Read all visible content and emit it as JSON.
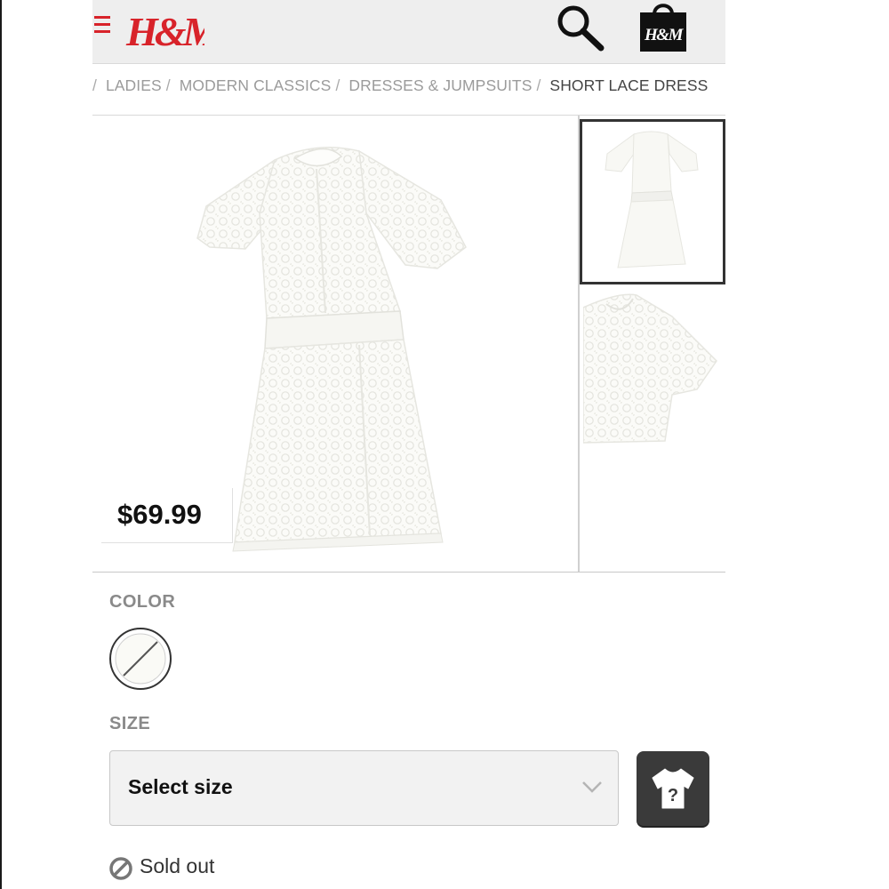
{
  "header": {
    "logo_text": "H&M",
    "bag_logo_text": "H&M",
    "icons": {
      "menu": "menu-icon",
      "search": "search-icon",
      "bag": "shopping-bag-icon"
    },
    "brand_color": "#d8232a"
  },
  "breadcrumb": {
    "separator": "/",
    "items": [
      "LADIES",
      "MODERN CLASSICS",
      "DRESSES & JUMPSUITS",
      "SHORT LACE DRESS"
    ]
  },
  "product": {
    "price": "$69.99",
    "image_color": "#ffffff"
  },
  "color": {
    "label": "COLOR",
    "swatch_icon": "white-swatch-icon"
  },
  "size": {
    "label": "SIZE",
    "select_value": "Select size",
    "size_guide_icon": "shirt-question-icon"
  },
  "status": {
    "text": "Sold out",
    "icon": "prohibited-icon"
  }
}
